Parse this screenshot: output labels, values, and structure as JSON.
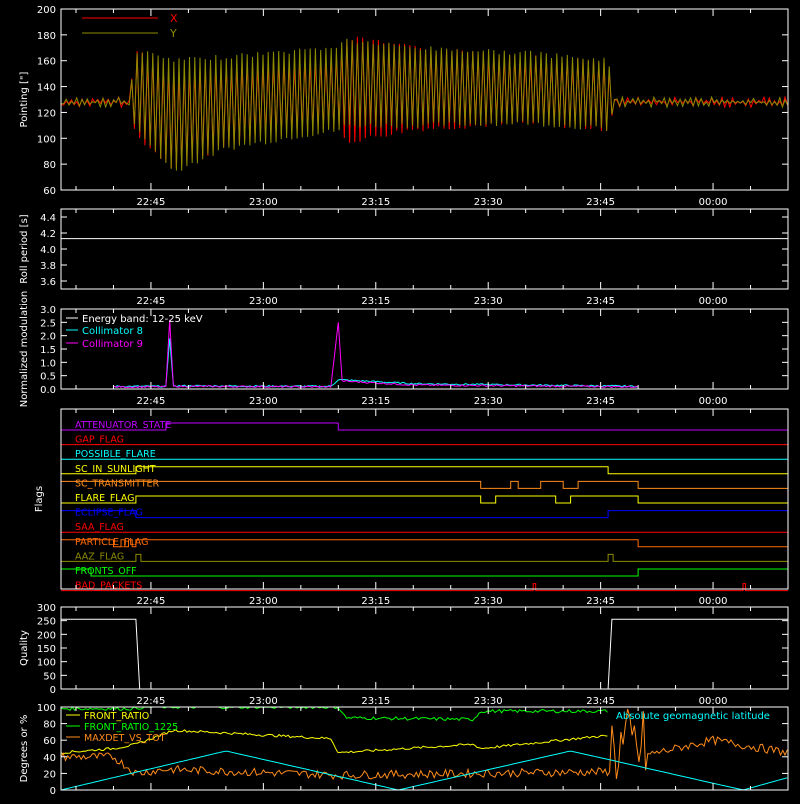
{
  "time_ticks": [
    "22:45",
    "23:00",
    "23:15",
    "23:30",
    "23:45",
    "00:00"
  ],
  "colors": {
    "background": "#000000",
    "axes": "#ffffff",
    "red": "#ff0000",
    "olive": "#8c8c00",
    "cyan": "#00ffff",
    "magenta": "#ff00ff",
    "blue": "#0000ff",
    "green": "#00ff00",
    "yellow": "#ffff00",
    "orange": "#ff8c1a",
    "dark_orange": "#ff6a00",
    "purple": "#c000ff"
  },
  "chart_data": [
    {
      "id": "pointing",
      "type": "line",
      "ylabel": "Pointing [\"]",
      "xlim": [
        "22:33",
        "00:10"
      ],
      "ylim": [
        60,
        200
      ],
      "yticks": [
        60,
        80,
        100,
        120,
        140,
        160,
        180,
        200
      ],
      "legend_position": "top-left",
      "series": [
        {
          "name": "X",
          "color": "#ff0000",
          "x": [
            "22:33",
            "22:42",
            "22:43",
            "22:48",
            "22:55",
            "23:05",
            "23:10",
            "23:11",
            "23:20",
            "23:35",
            "23:46",
            "23:47",
            "00:10"
          ],
          "upper": [
            128,
            128,
            170,
            155,
            158,
            162,
            165,
            180,
            172,
            165,
            160,
            128,
            128
          ],
          "lower": [
            128,
            128,
            100,
            75,
            92,
            105,
            108,
            95,
            105,
            110,
            105,
            128,
            128
          ]
        },
        {
          "name": "Y",
          "color": "#8c8c00",
          "x": [
            "22:33",
            "22:42",
            "22:43",
            "22:48",
            "22:55",
            "23:05",
            "23:10",
            "23:11",
            "23:20",
            "23:35",
            "23:46",
            "23:47",
            "00:10"
          ],
          "upper": [
            128,
            128,
            170,
            162,
            165,
            170,
            173,
            178,
            172,
            168,
            162,
            128,
            128
          ],
          "lower": [
            128,
            128,
            105,
            72,
            90,
            100,
            104,
            108,
            108,
            110,
            105,
            128,
            128
          ]
        }
      ]
    },
    {
      "id": "roll",
      "type": "line",
      "ylabel": "Roll period [s]",
      "ylim": [
        3.5,
        4.5
      ],
      "yticks": [
        3.6,
        3.8,
        4.0,
        4.2,
        4.4
      ],
      "series": [
        {
          "name": "",
          "color": "#ffffff",
          "x": [
            "22:33",
            "00:10"
          ],
          "y": [
            4.13,
            4.13
          ]
        }
      ]
    },
    {
      "id": "modulation",
      "type": "line",
      "ylabel": "Normalized modulation",
      "ylim": [
        0,
        3
      ],
      "yticks": [
        0.0,
        0.5,
        1.0,
        1.5,
        2.0,
        2.5,
        3.0
      ],
      "legend_position": "top-left",
      "legend_title": "Energy band: 12-25 keV",
      "series": [
        {
          "name": "Collimator 8",
          "color": "#00ffff",
          "x": [
            "22:40",
            "22:47",
            "22:47:30",
            "22:48",
            "23:09",
            "23:10",
            "23:20",
            "23:50"
          ],
          "y": [
            0.1,
            0.1,
            1.9,
            0.12,
            0.1,
            0.35,
            0.2,
            0.1
          ]
        },
        {
          "name": "Collimator 9",
          "color": "#ff00ff",
          "x": [
            "22:40",
            "22:47",
            "22:47:30",
            "22:48",
            "23:09",
            "23:10",
            "23:10:30",
            "23:20",
            "23:50"
          ],
          "y": [
            0.08,
            0.08,
            2.6,
            0.1,
            0.08,
            2.5,
            0.3,
            0.15,
            0.08
          ]
        }
      ]
    },
    {
      "id": "flags",
      "type": "line",
      "ylabel": "Flags",
      "flags": [
        {
          "name": "ATTENUATOR_STATE",
          "color": "#c000ff",
          "on": [
            [
              "22:47",
              "23:10"
            ]
          ]
        },
        {
          "name": "GAP_FLAG",
          "color": "#ff0000",
          "on": []
        },
        {
          "name": "POSSIBLE_FLARE",
          "color": "#00ffff",
          "on": []
        },
        {
          "name": "SC_IN_SUNLIGHT",
          "color": "#ffff00",
          "on": [
            [
              "22:43",
              "23:46"
            ]
          ]
        },
        {
          "name": "SC_TRANSMITTER",
          "color": "#ff8c1a",
          "on": [
            [
              "22:33",
              "23:29"
            ],
            [
              "23:33",
              "23:34"
            ],
            [
              "23:37",
              "23:40"
            ],
            [
              "23:42",
              "23:50"
            ]
          ]
        },
        {
          "name": "FLARE_FLAG",
          "color": "#ffff00",
          "on": [
            [
              "22:43",
              "23:29"
            ],
            [
              "23:31",
              "23:39"
            ],
            [
              "23:41",
              "23:50"
            ]
          ]
        },
        {
          "name": "ECLIPSE_FLAG",
          "color": "#0000ff",
          "on": [
            [
              "22:33",
              "22:43"
            ],
            [
              "23:46",
              "00:10"
            ]
          ]
        },
        {
          "name": "SAA_FLAG",
          "color": "#ff0000",
          "on": []
        },
        {
          "name": "PARTICLE_FLAG",
          "color": "#ff6a00",
          "on": [
            [
              "22:33",
              "22:40"
            ],
            [
              "22:41",
              "22:41:30"
            ],
            [
              "22:42",
              "22:42:30"
            ],
            [
              "22:43",
              "23:50"
            ]
          ]
        },
        {
          "name": "AAZ_FLAG",
          "color": "#8c8c00",
          "on": [
            [
              "22:43",
              "22:43:40"
            ],
            [
              "23:46",
              "23:46:40"
            ]
          ]
        },
        {
          "name": "FRONTS_OFF",
          "color": "#00ff00",
          "on": [
            [
              "22:33",
              "22:37"
            ],
            [
              "23:50",
              "00:10"
            ]
          ]
        },
        {
          "name": "BAD_PACKETS",
          "color": "#ff0000",
          "on": [
            [
              "23:36",
              "23:36:20"
            ],
            [
              "00:04",
              "00:04:20"
            ]
          ]
        }
      ]
    },
    {
      "id": "quality",
      "type": "line",
      "ylabel": "Quality",
      "ylim": [
        0,
        300
      ],
      "yticks": [
        0,
        50,
        100,
        150,
        200,
        250,
        300
      ],
      "series": [
        {
          "name": "",
          "color": "#ffffff",
          "x": [
            "22:33",
            "22:43",
            "22:43:30",
            "23:46",
            "23:46:30",
            "00:10"
          ],
          "y": [
            255,
            255,
            0,
            0,
            255,
            255
          ]
        }
      ]
    },
    {
      "id": "ratios",
      "type": "line",
      "ylabel": "Degrees or %",
      "ylim": [
        0,
        100
      ],
      "yticks": [
        0,
        20,
        40,
        60,
        80,
        100
      ],
      "series": [
        {
          "name": "FRONT_RATIO",
          "color": "#ffff00",
          "x": [
            "22:33",
            "22:40",
            "22:43",
            "22:48",
            "23:09",
            "23:10",
            "23:28",
            "23:29",
            "23:45",
            "23:46"
          ],
          "y": [
            45,
            50,
            55,
            72,
            62,
            45,
            55,
            50,
            65,
            65
          ]
        },
        {
          "name": "FRONT_RATIO_1225",
          "color": "#00ff00",
          "x": [
            "22:33",
            "22:43",
            "22:44",
            "23:10",
            "23:11",
            "23:28",
            "23:29",
            "23:46"
          ],
          "y": [
            98,
            98,
            100,
            100,
            87,
            85,
            95,
            95
          ]
        },
        {
          "name": "MAXDET_VS_TOT",
          "color": "#ff8c1a",
          "x": [
            "22:33",
            "22:40",
            "22:43",
            "22:47",
            "23:10",
            "23:46",
            "23:50",
            "00:00",
            "00:10"
          ],
          "y": [
            40,
            40,
            20,
            25,
            18,
            22,
            40,
            60,
            45
          ]
        },
        {
          "name": "Absolute geomagnetic latitude",
          "color": "#00ffff",
          "x": [
            "22:33",
            "22:55",
            "23:18",
            "23:41",
            "00:04",
            "00:10"
          ],
          "y": [
            0,
            47,
            0,
            47,
            0,
            15
          ]
        }
      ]
    }
  ]
}
